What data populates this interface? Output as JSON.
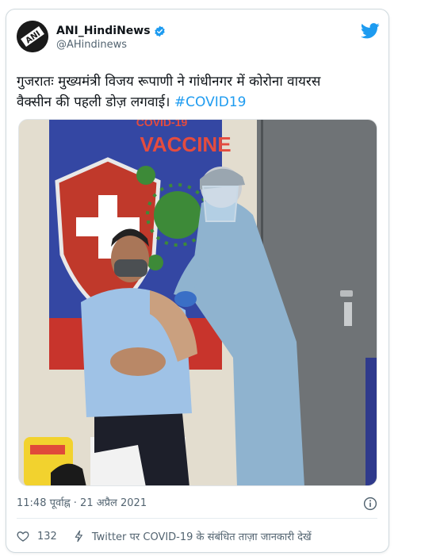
{
  "account": {
    "display_name": "ANI_HindiNews",
    "handle": "@AHindinews",
    "avatar_text": "ANI"
  },
  "tweet": {
    "text_line1": "गुजरातः मुख्यमंत्री विजय रूपाणी ने गांधीनगर में कोरोना वायरस",
    "text_line2": "वैक्सीन की पहली डोज़ लगवाई। ",
    "hashtag": "#COVID19"
  },
  "media": {
    "poster_text_top": "COVID-19",
    "poster_text_main": "VACCINE"
  },
  "meta": {
    "timestamp": "11:48 पूर्वाह्न · 21 अप्रैल 2021"
  },
  "actions": {
    "like_count": "132",
    "topic_text": "Twitter पर COVID-19 के संबंधित ताज़ा जानकारी देखें"
  },
  "colors": {
    "accent": "#1d9bf0",
    "text": "#0f1419",
    "muted": "#536471"
  },
  "icons": [
    "ani-logo",
    "verified-badge-icon",
    "twitter-bird-icon",
    "info-icon",
    "heart-icon",
    "lightning-icon"
  ]
}
